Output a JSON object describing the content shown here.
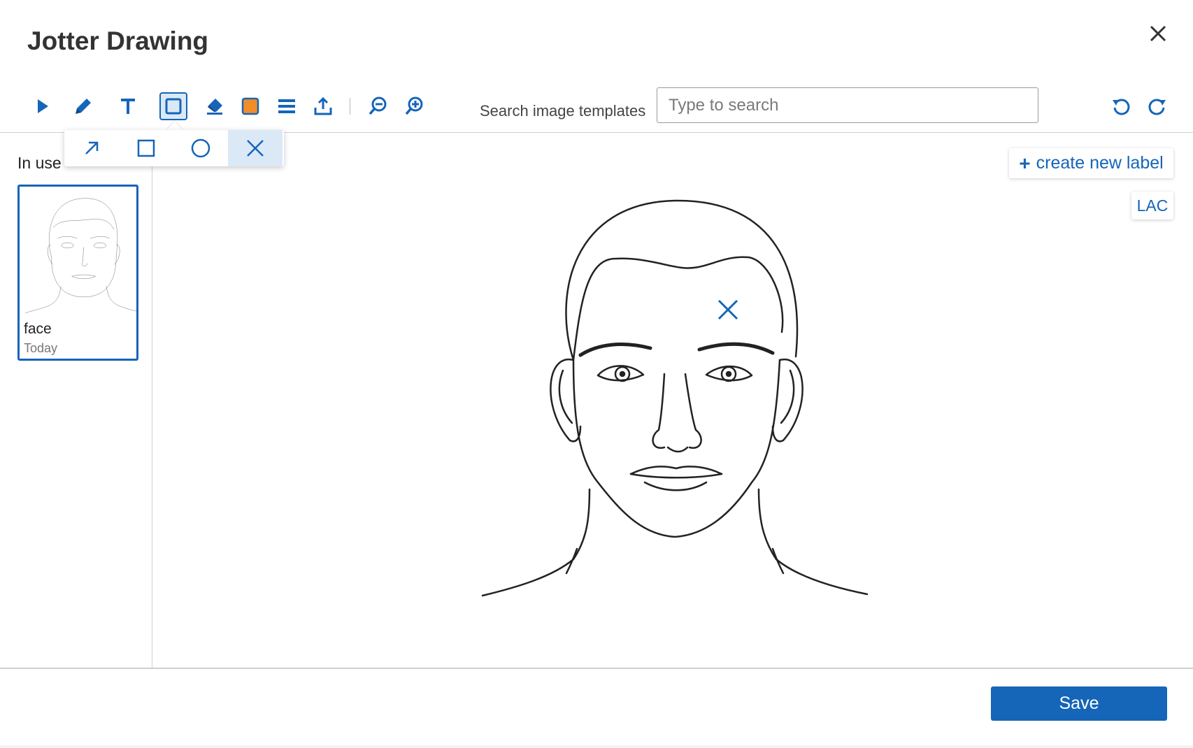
{
  "dialog": {
    "title": "Jotter Drawing"
  },
  "toolbar": {
    "tools": [
      {
        "name": "select",
        "icon": "play-icon"
      },
      {
        "name": "pencil",
        "icon": "pencil-icon"
      },
      {
        "name": "text",
        "icon": "text-icon"
      },
      {
        "name": "shape",
        "icon": "square-icon",
        "active": true
      },
      {
        "name": "eraser",
        "icon": "eraser-icon"
      },
      {
        "name": "color",
        "icon": "color-swatch-icon",
        "color": "#f28c28"
      },
      {
        "name": "line-weight",
        "icon": "line-weight-icon"
      },
      {
        "name": "upload",
        "icon": "upload-icon"
      },
      {
        "name": "zoom-out",
        "icon": "zoom-out-icon"
      },
      {
        "name": "zoom-in",
        "icon": "zoom-in-icon"
      }
    ],
    "search_label": "Search image templates",
    "search_placeholder": "Type to search",
    "search_value": ""
  },
  "shape_popup": {
    "items": [
      {
        "name": "arrow",
        "icon": "arrow-icon"
      },
      {
        "name": "rectangle",
        "icon": "rectangle-icon"
      },
      {
        "name": "circle",
        "icon": "circle-icon"
      },
      {
        "name": "cross",
        "icon": "cross-icon",
        "active": true
      }
    ]
  },
  "sidebar": {
    "heading": "In use",
    "templates": [
      {
        "name": "face",
        "date": "Today",
        "selected": true
      }
    ]
  },
  "canvas": {
    "create_label": "create new label",
    "create_label_icon": "plus-icon",
    "labels": [
      "LAC"
    ],
    "image": "face-drawing",
    "annotation_icon": "cross-mark-icon"
  },
  "footer": {
    "save_label": "Save"
  },
  "colors": {
    "accent": "#1565b8",
    "accent_light": "#dbe9f7",
    "swatch": "#f28c28"
  }
}
